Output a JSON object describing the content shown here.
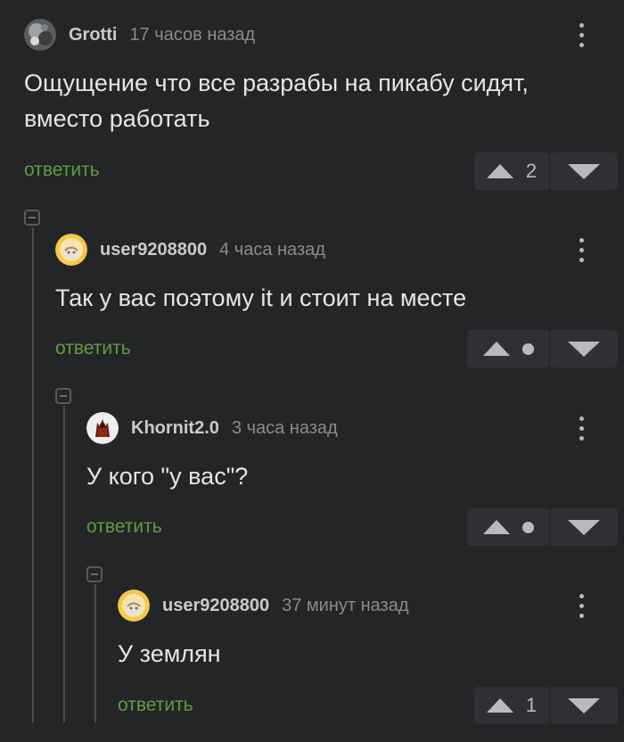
{
  "comments": [
    {
      "author": "Grotti",
      "time": "17 часов назад",
      "text_line1": "Ощущение что все разрабы на пикабу сидят,",
      "text_line2": "вместо работать",
      "reply_label": "ответить",
      "rating": "2"
    },
    {
      "author": "user9208800",
      "time": "4 часа назад",
      "text": "Так у вас поэтому it и стоит на месте",
      "reply_label": "ответить",
      "rating": "hidden"
    },
    {
      "author": "Khornit2.0",
      "time": "3 часа назад",
      "text": "У кого \"у вас\"?",
      "reply_label": "ответить",
      "rating": "hidden"
    },
    {
      "author": "user9208800",
      "time": "37 минут назад",
      "text": "У землян",
      "reply_label": "ответить",
      "rating": "1"
    }
  ],
  "colors": {
    "background": "#242527",
    "reply_green": "#5e9c47",
    "text": "#e6e6e6"
  },
  "icons": [
    "avatar",
    "more-vertical-icon",
    "upvote-icon",
    "downvote-icon",
    "collapse-thread-icon"
  ]
}
